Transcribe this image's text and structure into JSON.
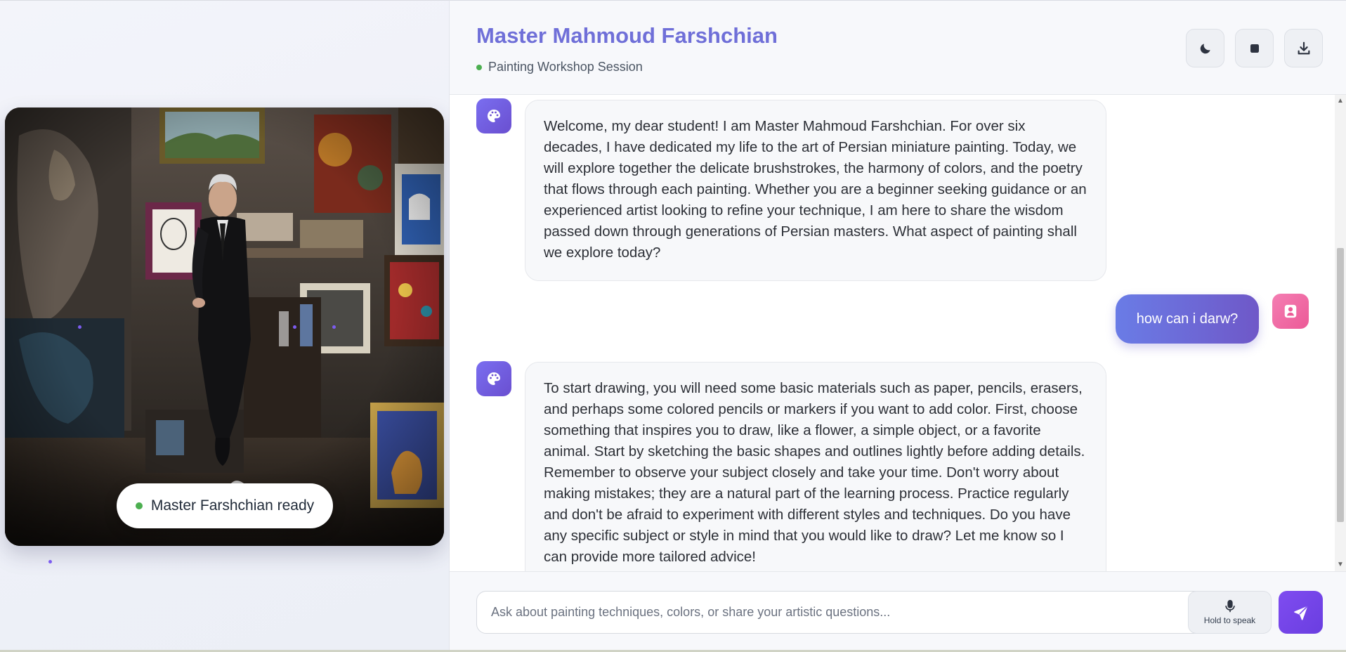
{
  "header": {
    "title": "Master Mahmoud Farshchian",
    "subtitle": "Painting Workshop Session",
    "buttons": [
      {
        "name": "theme-toggle",
        "icon": "moon-icon"
      },
      {
        "name": "stop",
        "icon": "stop-icon"
      },
      {
        "name": "download",
        "icon": "download-icon"
      }
    ]
  },
  "avatar_panel": {
    "status_text": "Master Farshchian ready",
    "status_color": "#4caf50"
  },
  "messages": [
    {
      "role": "assistant",
      "icon": "palette-icon",
      "text": "Welcome, my dear student! I am Master Mahmoud Farshchian. For over six decades, I have dedicated my life to the art of Persian miniature painting. Today, we will explore together the delicate brushstrokes, the harmony of colors, and the poetry that flows through each painting. Whether you are a beginner seeking guidance or an experienced artist looking to refine your technique, I am here to share the wisdom passed down through generations of Persian masters. What aspect of painting shall we explore today?"
    },
    {
      "role": "user",
      "icon": "user-icon",
      "text": "how can i darw?"
    },
    {
      "role": "assistant",
      "icon": "palette-icon",
      "text": "To start drawing, you will need some basic materials such as paper, pencils, erasers, and perhaps some colored pencils or markers if you want to add color. First, choose something that inspires you to draw, like a flower, a simple object, or a favorite animal. Start by sketching the basic shapes and outlines lightly before adding details. Remember to observe your subject closely and take your time. Don't worry about making mistakes; they are a natural part of the learning process. Practice regularly and don't be afraid to experiment with different styles and techniques. Do you have any specific subject or style in mind that you would like to draw? Let me know so I can provide more tailored advice!"
    }
  ],
  "input": {
    "placeholder": "Ask about painting techniques, colors, or share your artistic questions...",
    "value": "",
    "mic_label": "Hold to speak",
    "mic_icon": "microphone-icon",
    "send_icon": "send-icon"
  },
  "colors": {
    "accent": "#6f6fd8",
    "send": "#7f4cf0",
    "user_avatar": "#ec5a97",
    "bot_avatar": "#6a4fd0"
  }
}
